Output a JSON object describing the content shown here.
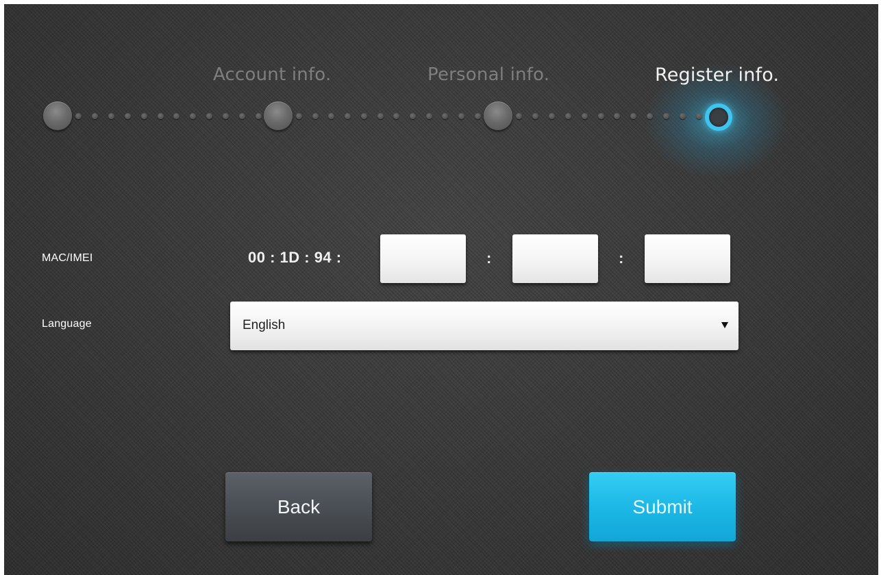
{
  "steps": {
    "labels": [
      "Account info.",
      "Personal info.",
      "Register info."
    ],
    "active_index": 2,
    "accent_color": "#3ec4ef"
  },
  "form": {
    "mac": {
      "label": "MAC/IMEI",
      "prefix": "00 : 1D : 94 :",
      "separator": ":",
      "segments": [
        "",
        "",
        ""
      ]
    },
    "language": {
      "label": "Language",
      "selected": "English"
    }
  },
  "buttons": {
    "back": "Back",
    "submit": "Submit",
    "submit_color": "#1db8e6"
  }
}
